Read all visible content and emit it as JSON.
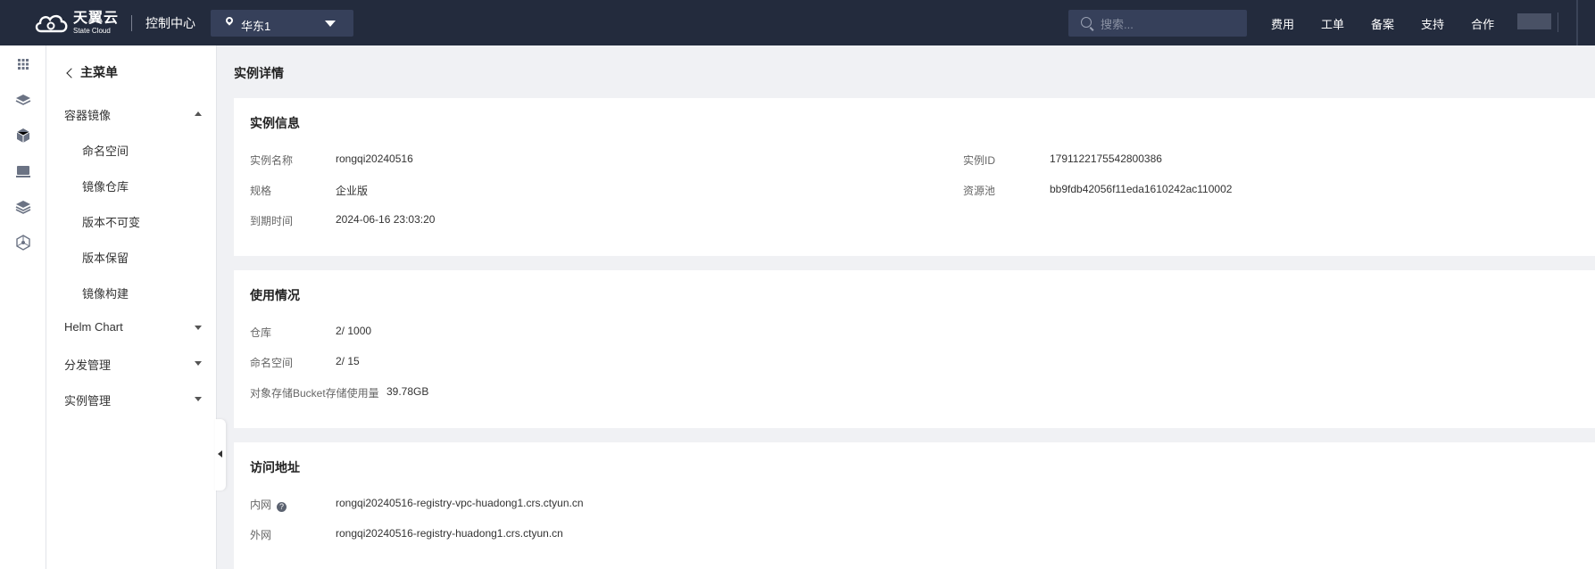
{
  "header": {
    "logo_cn": "天翼云",
    "logo_en": "State Cloud",
    "console_title": "控制中心",
    "region": "华东1",
    "search_placeholder": "搜索...",
    "nav": [
      "费用",
      "工单",
      "备案",
      "支持",
      "合作"
    ]
  },
  "rail": {
    "icons": [
      "grid-icon",
      "layers-icon",
      "cube-icon",
      "device-icon",
      "stack-icon",
      "network-icon"
    ]
  },
  "sidebar": {
    "back_label": "主菜单",
    "groups": [
      {
        "label": "容器镜像",
        "expanded": true,
        "items": [
          "命名空间",
          "镜像仓库",
          "版本不可变",
          "版本保留",
          "镜像构建"
        ]
      },
      {
        "label": "Helm Chart",
        "expanded": false
      },
      {
        "label": "分发管理",
        "expanded": false
      },
      {
        "label": "实例管理",
        "expanded": false
      }
    ]
  },
  "main": {
    "page_title": "实例详情",
    "instance_info": {
      "title": "实例信息",
      "name_label": "实例名称",
      "name_value": "rongqi20240516",
      "spec_label": "规格",
      "spec_value": "企业版",
      "expire_label": "到期时间",
      "expire_value": "2024-06-16 23:03:20",
      "id_label": "实例ID",
      "id_value": "1791122175542800386",
      "pool_label": "资源池",
      "pool_value": "bb9fdb42056f11eda1610242ac110002"
    },
    "usage": {
      "title": "使用情况",
      "repo_label": "仓库",
      "repo_value": "2/ 1000",
      "ns_label": "命名空间",
      "ns_value": "2/ 15",
      "bucket_label": "对象存储Bucket存储使用量",
      "bucket_value": "39.78GB"
    },
    "access": {
      "title": "访问地址",
      "internal_label": "内网",
      "internal_value": "rongqi20240516-registry-vpc-huadong1.crs.ctyun.cn",
      "external_label": "外网",
      "external_value": "rongqi20240516-registry-huadong1.crs.ctyun.cn"
    }
  }
}
